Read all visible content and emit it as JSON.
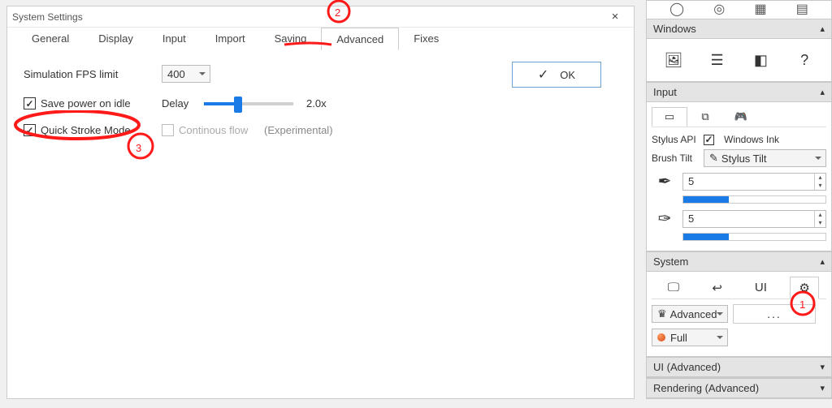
{
  "window": {
    "title": "System Settings",
    "tabs": [
      "General",
      "Display",
      "Input",
      "Import",
      "Saving",
      "Advanced",
      "Fixes"
    ],
    "active_tab": "Advanced",
    "ok_label": "OK"
  },
  "advanced": {
    "fps_label": "Simulation FPS limit",
    "fps_value": "400",
    "save_power_label": "Save power on idle",
    "save_power_checked": true,
    "delay_label": "Delay",
    "delay_value": "2.0x",
    "quick_stroke_label": "Quick Stroke Mode",
    "quick_stroke_checked": true,
    "continuous_flow_label": "Continous flow",
    "continuous_flow_checked": false,
    "experimental_label": "(Experimental)"
  },
  "panels": {
    "windows": {
      "title": "Windows"
    },
    "input": {
      "title": "Input",
      "stylus_api_label": "Stylus API",
      "windows_ink_label": "Windows Ink",
      "windows_ink_checked": true,
      "brush_tilt_label": "Brush Tilt",
      "brush_tilt_value": "Stylus Tilt",
      "tilt_a": "5",
      "tilt_b": "5"
    },
    "system": {
      "title": "System",
      "preset": "Advanced",
      "browse": "...",
      "detail": "Full"
    },
    "ui": {
      "title": "UI (Advanced)"
    },
    "rendering": {
      "title": "Rendering (Advanced)"
    }
  },
  "annotations": {
    "1": "1",
    "2": "2",
    "3": "3"
  }
}
